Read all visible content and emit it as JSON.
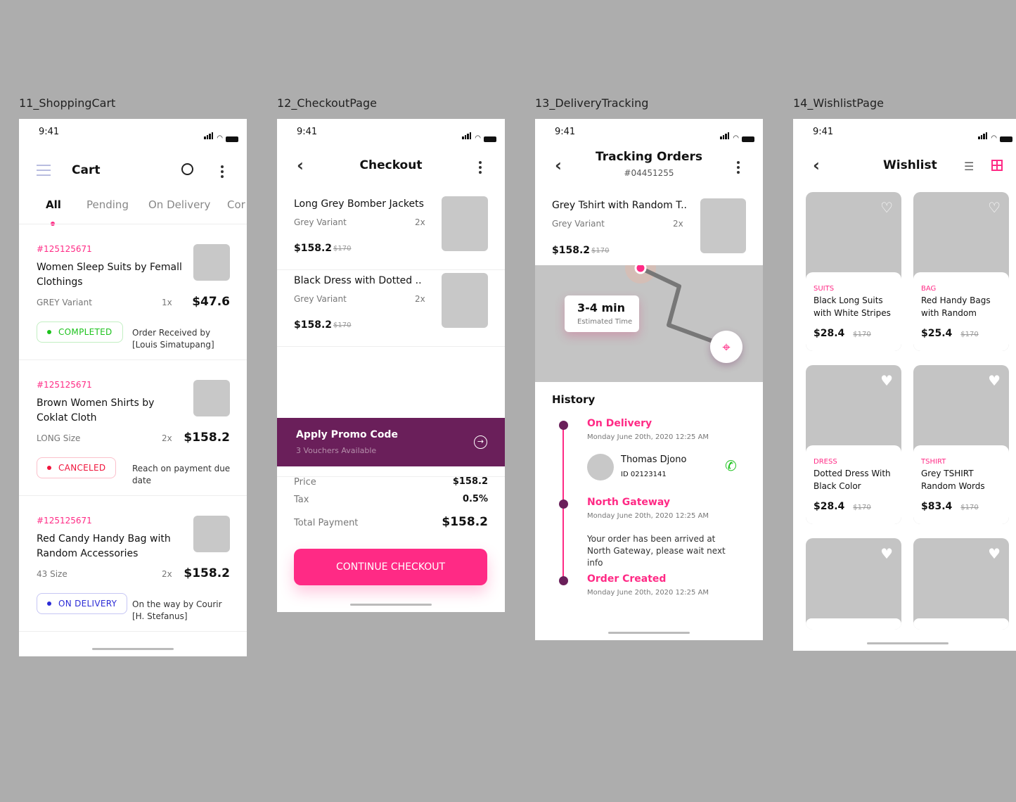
{
  "labels": [
    "11_ShoppingCart",
    "12_CheckoutPage",
    "13_DeliveryTracking",
    "14_WishlistPage"
  ],
  "status_time": "9:41",
  "cart": {
    "title": "Cart",
    "tabs": [
      "All",
      "Pending",
      "On Delivery",
      "Cor"
    ],
    "orders": [
      {
        "id": "#125125671",
        "name": "Women Sleep Suits by Femall Clothings",
        "variant": "GREY Variant",
        "qty": "1x",
        "price": "$47.6",
        "status": "COMPLETED",
        "status_color": "#1cc21c",
        "note": "Order Received by [Louis Simatupang]"
      },
      {
        "id": "#125125671",
        "name": "Brown Women Shirts by Coklat Cloth",
        "variant": "LONG Size",
        "qty": "2x",
        "price": "$158.2",
        "status": "CANCELED",
        "status_color": "#f0143c",
        "note": "Reach on payment due date"
      },
      {
        "id": "#125125671",
        "name": "Red Candy Handy Bag with Random Accessories",
        "variant": "43 Size",
        "qty": "2x",
        "price": "$158.2",
        "status": "ON DELIVERY",
        "status_color": "#2b2bd6",
        "note": "On the way by Courir [H. Stefanus]"
      }
    ]
  },
  "checkout": {
    "title": "Checkout",
    "items": [
      {
        "name": "Long Grey Bomber Jackets",
        "variant": "Grey Variant",
        "qty": "2x",
        "price": "$158.2",
        "old_price": "$170"
      },
      {
        "name": "Black Dress with Dotted ..",
        "variant": "Grey Variant",
        "qty": "2x",
        "price": "$158.2",
        "old_price": "$170"
      }
    ],
    "promo": {
      "title": "Apply Promo Code",
      "subtitle": "3 Vouchers Available"
    },
    "summary": {
      "price_label": "Price",
      "price": "$158.2",
      "tax_label": "Tax",
      "tax": "0.5%",
      "total_label": "Total Payment",
      "total": "$158.2"
    },
    "cta": "CONTINUE CHECKOUT"
  },
  "tracking": {
    "title": "Tracking Orders",
    "order_id": "#04451255",
    "item": {
      "name": "Grey Tshirt with Random T..",
      "variant": "Grey Variant",
      "qty": "2x",
      "price": "$158.2",
      "old_price": "$170"
    },
    "eta": "3-4 min",
    "eta_label": "Estimated Time",
    "history_title": "History",
    "history": [
      {
        "title": "On Delivery",
        "date": "Monday June 20th, 2020  12:25 AM"
      },
      {
        "title": "North Gateway",
        "date": "Monday June 20th, 2020  12:25 AM",
        "detail": "Your order has been arrived at North Gateway, please wait next info"
      },
      {
        "title": "Order Created",
        "date": "Monday June 20th, 2020  12:25 AM"
      }
    ],
    "courier": {
      "name": "Thomas Djono",
      "id": "ID 02123141"
    }
  },
  "wishlist": {
    "title": "Wishlist",
    "items": [
      {
        "category": "SUITS",
        "name": "Black Long Suits with White Stripes",
        "price": "$28.4",
        "old_price": "$170",
        "liked": false
      },
      {
        "category": "BAG",
        "name": "Red Handy Bags with Random",
        "price": "$25.4",
        "old_price": "$170",
        "liked": false
      },
      {
        "category": "DRESS",
        "name": "Dotted Dress With Black Color",
        "price": "$28.4",
        "old_price": "$170",
        "liked": true
      },
      {
        "category": "TSHIRT",
        "name": "Grey TSHIRT Random Words",
        "price": "$83.4",
        "old_price": "$170",
        "liked": true
      },
      {
        "category": "",
        "name": "",
        "price": "",
        "old_price": "",
        "liked": true
      },
      {
        "category": "",
        "name": "",
        "price": "",
        "old_price": "",
        "liked": true
      }
    ]
  },
  "colors": {
    "accent": "#ff2a85",
    "promo_bg": "#6a1f5a",
    "timeline": "#6a1f5a"
  }
}
